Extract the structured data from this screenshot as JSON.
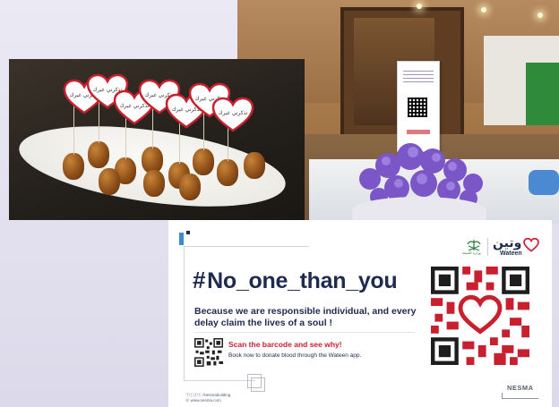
{
  "photos": {
    "dates_tag_text": "تذكرني غيرك",
    "stand_text": "تبرعك ينقذ حياة"
  },
  "poster": {
    "hashtag_symbol": "#",
    "hashtag_text": "No_one_than_you",
    "tagline": "Because we are responsible individual, and every delay claim the lives of a soul !",
    "scan_title": "Scan the barcode and see why!",
    "scan_sub": "Book now to donate blood through the Wateen app.",
    "social_handle": "ⓕⓘⓨⓣ /Nesmabuilding",
    "website": "ⓦ www.nesma.com",
    "brand_ar": "وتين",
    "brand_en": "Wateen",
    "ministry_ar": "وزارة الصحة",
    "ministry_en": "Ministry of Health",
    "builder": "NESMA",
    "colors": {
      "navy": "#1f2a4f",
      "red": "#c8202e",
      "blue_accent": "#3b8dd0"
    },
    "icons": [
      "qr-code-icon",
      "heart-icon",
      "ministry-emblem-icon"
    ]
  }
}
